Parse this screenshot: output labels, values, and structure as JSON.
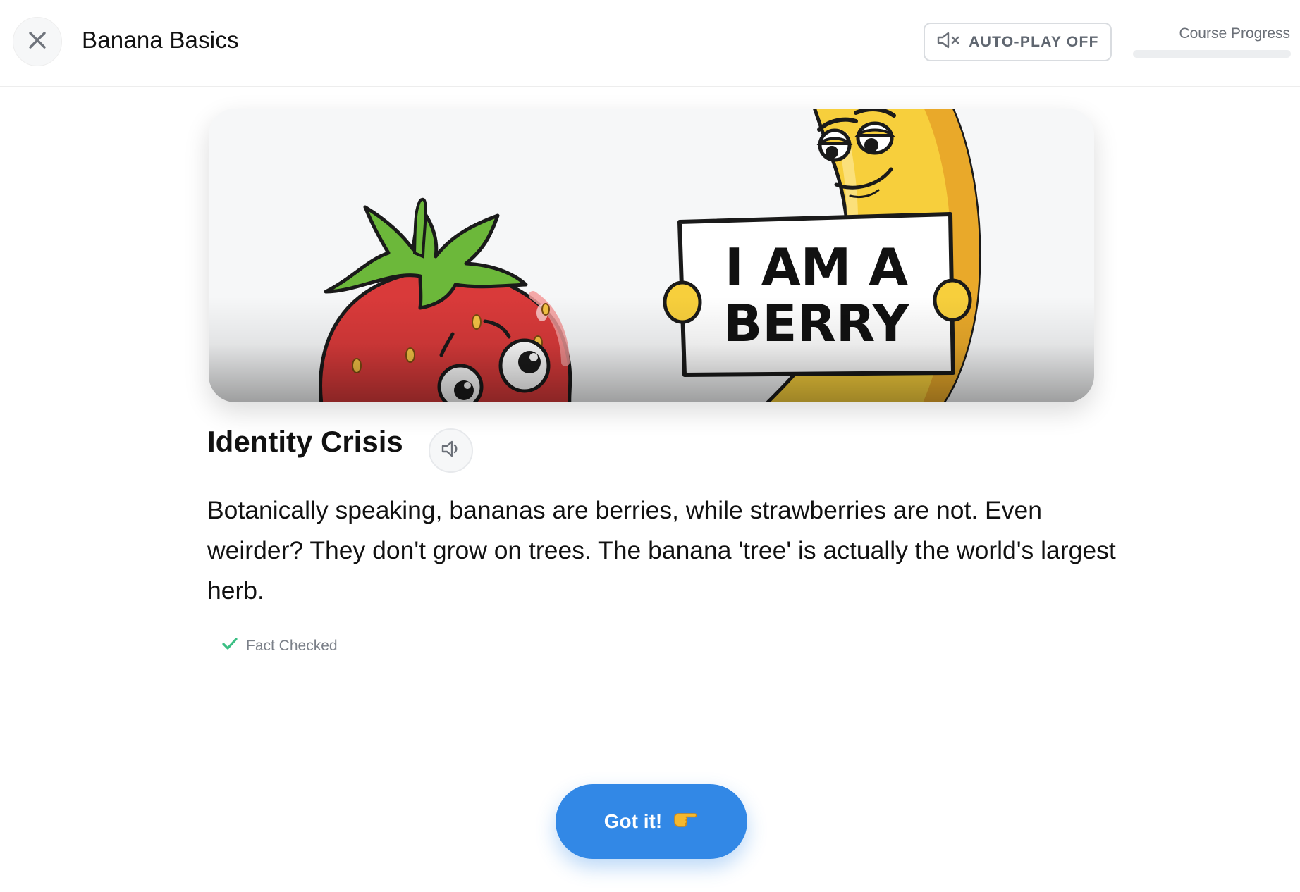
{
  "header": {
    "title": "Banana Basics",
    "close_icon": "close-icon",
    "autoplay": {
      "label": "AUTO-PLAY OFF",
      "icon": "speaker-muted-icon"
    },
    "progress": {
      "label": "Course Progress",
      "value_percent": 0
    }
  },
  "hero": {
    "sign_line_1": "I AM A",
    "sign_line_2": "BERRY"
  },
  "card": {
    "title": "Identity Crisis",
    "audio_icon": "speaker-icon",
    "body": "Botanically speaking, bananas are berries, while strawberries are not. Even weirder? They don't grow on trees. The banana 'tree' is actually the world's largest herb.",
    "fact_checked_label": "Fact Checked",
    "fact_checked_icon": "checkmark-icon"
  },
  "actions": {
    "continue_label": "Got it!",
    "continue_icon": "pointing-hand-emoji"
  },
  "colors": {
    "accent": "#3288e6",
    "check_green": "#3bbf84",
    "muted_text": "#6b7078"
  }
}
